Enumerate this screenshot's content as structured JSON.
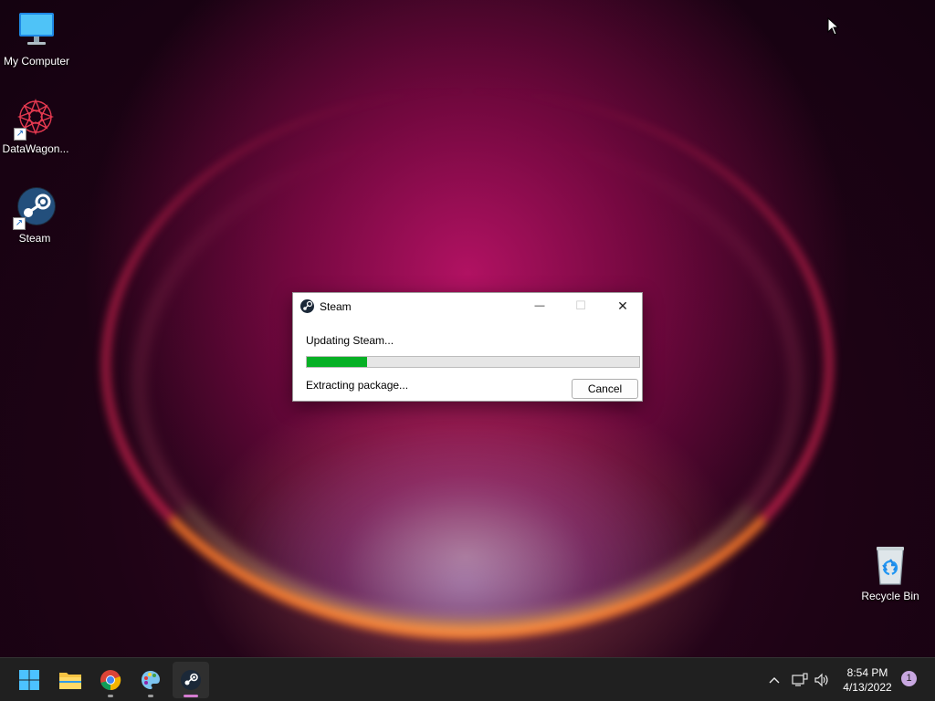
{
  "desktop": {
    "icons": [
      {
        "label": "My Computer",
        "icon": "monitor-icon"
      },
      {
        "label": "DataWagon...",
        "icon": "datawagon-icon"
      },
      {
        "label": "Steam",
        "icon": "steam-icon"
      },
      {
        "label": "Recycle Bin",
        "icon": "recycle-bin-icon"
      }
    ]
  },
  "dialog": {
    "title": "Steam",
    "status": "Updating Steam...",
    "detail": "Extracting package...",
    "progress": 0.18,
    "cancel_label": "Cancel",
    "controls": {
      "minimize": "—",
      "maximize": "☐",
      "close": "✕"
    }
  },
  "taskbar": {
    "apps": [
      {
        "name": "start",
        "icon": "windows-start-icon"
      },
      {
        "name": "file-explorer",
        "icon": "folder-icon"
      },
      {
        "name": "chrome",
        "icon": "chrome-icon"
      },
      {
        "name": "paint",
        "icon": "paint-icon"
      },
      {
        "name": "steam",
        "icon": "steam-icon",
        "active": true
      }
    ],
    "tray": {
      "chevron": "^",
      "time": "8:54 PM",
      "date": "4/13/2022",
      "notification_count": "1"
    }
  },
  "colors": {
    "progress_fill": "#06b025",
    "taskbar_bg": "#202020",
    "active_indicator": "#d57cd0"
  }
}
